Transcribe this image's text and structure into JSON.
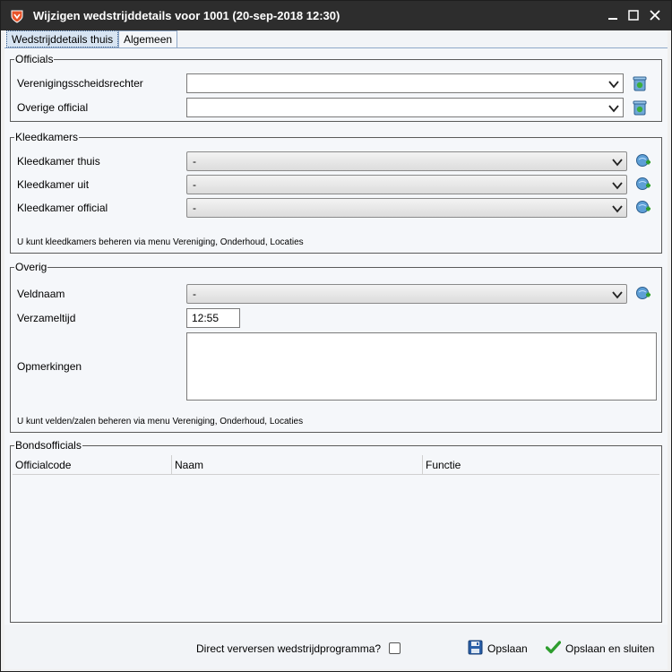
{
  "window": {
    "title": "Wijzigen wedstrijddetails voor 1001 (20-sep-2018 12:30)",
    "colors": {
      "titlebar": "#2d2d2d",
      "accent": "#e8542a"
    }
  },
  "tabs": [
    {
      "label": "Wedstrijddetails thuis",
      "active": true
    },
    {
      "label": "Algemeen",
      "active": false
    }
  ],
  "officials": {
    "legend": "Officials",
    "rows": [
      {
        "label": "Verenigingsscheidsrechter",
        "value": ""
      },
      {
        "label": "Overige official",
        "value": ""
      }
    ]
  },
  "kleedkamers": {
    "legend": "Kleedkamers",
    "rows": [
      {
        "label": "Kleedkamer thuis",
        "value": "-"
      },
      {
        "label": "Kleedkamer uit",
        "value": "-"
      },
      {
        "label": "Kleedkamer official",
        "value": "-"
      }
    ],
    "note": "U kunt kleedkamers beheren via menu Vereniging, Onderhoud, Locaties"
  },
  "overig": {
    "legend": "Overig",
    "veldnaam_label": "Veldnaam",
    "veldnaam_value": "-",
    "verzameltijd_label": "Verzameltijd",
    "verzameltijd_value": "12:55",
    "opmerkingen_label": "Opmerkingen",
    "opmerkingen_value": "",
    "note": "U kunt velden/zalen beheren via menu Vereniging, Onderhoud, Locaties"
  },
  "bondsofficials": {
    "legend": "Bondsofficials",
    "columns": [
      "Officialcode",
      "Naam",
      "Functie"
    ],
    "rows": []
  },
  "footer": {
    "checkbox_label": "Direct verversen wedstrijdprogramma?",
    "checked": false,
    "save_label": "Opslaan",
    "save_close_label": "Opslaan en sluiten"
  }
}
